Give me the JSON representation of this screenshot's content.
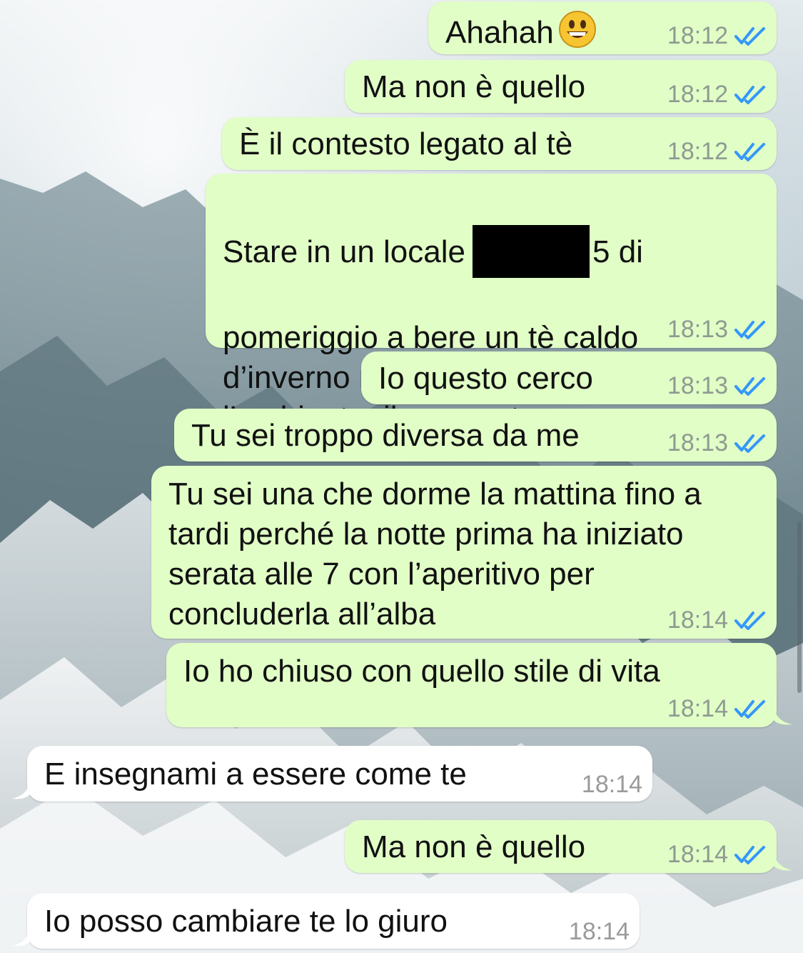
{
  "messages": [
    {
      "text": "Ahahah",
      "time": "18:12",
      "emoji": "grinning-face"
    },
    {
      "text": "Ma non è quello",
      "time": "18:12"
    },
    {
      "text": "È il contesto legato al tè",
      "time": "18:12"
    },
    {
      "text_a": "Stare in un locale",
      "text_b": "5 di",
      "text_c": "pomeriggio a bere un tè caldo\nd’inverno nel relax totale e godersi\nl’ambiente, il momento",
      "time": "18:13"
    },
    {
      "text": "Io questo cerco",
      "time": "18:13"
    },
    {
      "text": "Tu sei troppo diversa da me",
      "time": "18:13"
    },
    {
      "text": "Tu sei una che dorme la mattina fino a\ntardi perché la notte prima ha iniziato\nserata alle 7 con l’aperitivo per\nconcluderla all’alba",
      "time": "18:14"
    },
    {
      "text": "Io ho chiuso con quello stile di vita",
      "time": "18:14"
    },
    {
      "text": "E insegnami a essere come te",
      "time": "18:14"
    },
    {
      "text": "Ma non è quello",
      "time": "18:14"
    },
    {
      "text": "Io posso cambiare te lo giuro",
      "time": "18:14"
    }
  ],
  "colors": {
    "outgoing_bubble": "#e1fec6",
    "incoming_bubble": "#ffffff",
    "read_ticks": "#3497f9",
    "timestamp": "#8e9a92"
  },
  "icons": {
    "read_receipt": "double-check-icon",
    "emoji": "grinning-face-emoji",
    "redaction": "black-redaction-box"
  }
}
